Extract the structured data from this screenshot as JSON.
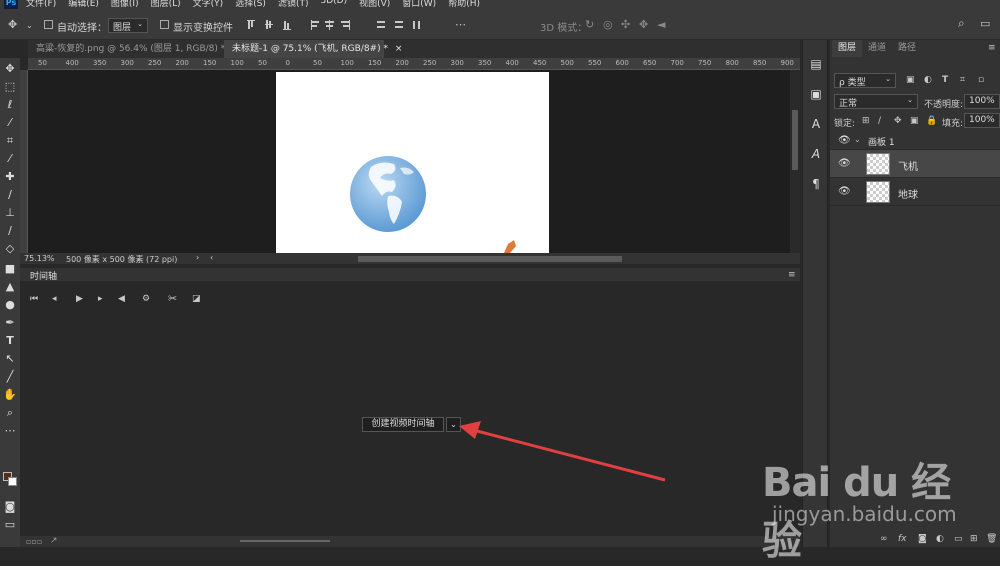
{
  "menubar": {
    "app_icon": "Ps",
    "items": [
      "文件(F)",
      "编辑(E)",
      "图像(I)",
      "图层(L)",
      "文字(Y)",
      "选择(S)",
      "滤镜(T)",
      "3D(D)",
      "视图(V)",
      "窗口(W)",
      "帮助(H)"
    ]
  },
  "options": {
    "auto_select_label": "自动选择：",
    "auto_select_value": "图层",
    "show_transform_label": "显示变换控件",
    "mode_3d_label": "3D 模式："
  },
  "tabs": [
    {
      "label": "高粱-恢复的.png @ 56.4% (图层 1, RGB/8) *",
      "close": "×"
    },
    {
      "label": "未标题-1 @ 75.1% (飞机, RGB/8#) *",
      "close": "×"
    }
  ],
  "ruler": {
    "ticks": [
      "50",
      "400",
      "350",
      "300",
      "250",
      "200",
      "150",
      "100",
      "50",
      "0",
      "50",
      "100",
      "150",
      "200",
      "250",
      "300",
      "350",
      "400",
      "450",
      "500",
      "550",
      "600",
      "650",
      "700",
      "750",
      "800",
      "850",
      "900"
    ]
  },
  "status": {
    "zoom": "75.13%",
    "doc_info": "500 像素 x 500 像素 (72 ppi)"
  },
  "timeline": {
    "title": "时间轴",
    "create_button": "创建视频时间轴",
    "dropdown_glyph": "⌄"
  },
  "layers_panel": {
    "tabs": [
      "图层",
      "通道",
      "路径"
    ],
    "filter_kind": "ρ 类型",
    "blend_mode": "正常",
    "opacity_label": "不透明度:",
    "opacity_value": "100%",
    "lock_label": "锁定:",
    "fill_label": "填充:",
    "fill_value": "100%",
    "artboard": "画板 1",
    "layers": [
      {
        "name": "飞机",
        "selected": true
      },
      {
        "name": "地球",
        "selected": false
      }
    ]
  },
  "watermark": {
    "logo": "Bai du 经验",
    "url": "jingyan.baidu.com"
  },
  "colors": {
    "arrow": "#e04040",
    "panel_bg": "#333333",
    "canvas_bg": "#1e1e1e",
    "earth": "#6fa8dc"
  }
}
